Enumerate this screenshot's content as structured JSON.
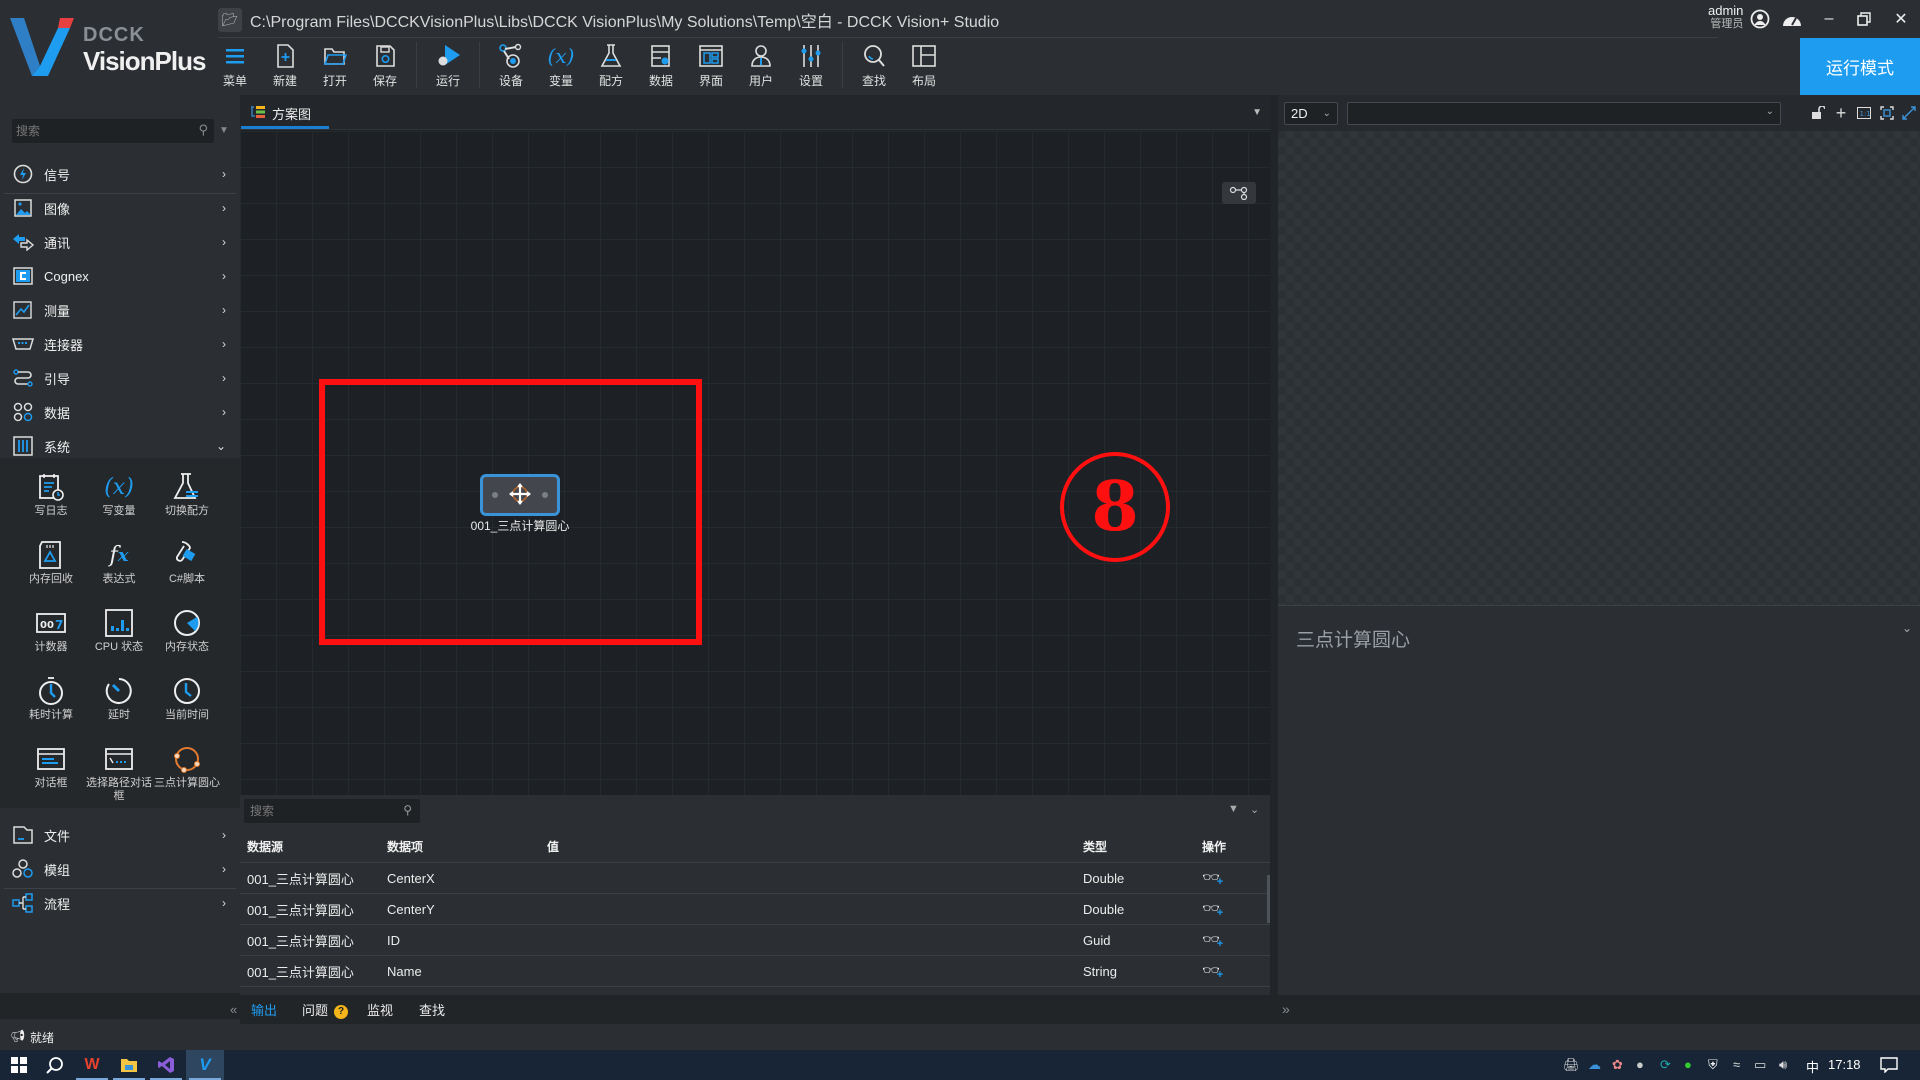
{
  "app": {
    "brand_top": "DCCK",
    "brand_bottom": "VisionPlus",
    "window_title": "C:\\Program Files\\DCCKVisionPlus\\Libs\\DCCK VisionPlus\\My Solutions\\Temp\\空白 - DCCK Vision+ Studio",
    "user_name": "admin",
    "user_role": "管理员",
    "run_mode_label": "运行模式",
    "accent_color": "#1e9cf0"
  },
  "toolbar": {
    "items": [
      {
        "label": "菜单",
        "icon": "menu-icon"
      },
      {
        "label": "新建",
        "icon": "new-file-icon"
      },
      {
        "label": "打开",
        "icon": "open-folder-icon"
      },
      {
        "label": "保存",
        "icon": "save-icon"
      },
      {
        "label": "运行",
        "icon": "run-icon"
      },
      {
        "label": "设备",
        "icon": "device-icon"
      },
      {
        "label": "变量",
        "icon": "variable-icon"
      },
      {
        "label": "配方",
        "icon": "recipe-icon"
      },
      {
        "label": "数据",
        "icon": "data-icon"
      },
      {
        "label": "界面",
        "icon": "interface-icon"
      },
      {
        "label": "用户",
        "icon": "user-icon"
      },
      {
        "label": "设置",
        "icon": "settings-icon"
      },
      {
        "label": "查找",
        "icon": "search-icon"
      },
      {
        "label": "布局",
        "icon": "layout-icon"
      }
    ]
  },
  "sidebar": {
    "search_placeholder": "搜索",
    "categories": [
      {
        "label": "信号",
        "icon": "signal-icon"
      },
      {
        "label": "图像",
        "icon": "image-icon"
      },
      {
        "label": "通讯",
        "icon": "communication-icon"
      },
      {
        "label": "Cognex",
        "icon": "cognex-icon"
      },
      {
        "label": "测量",
        "icon": "measure-icon"
      },
      {
        "label": "连接器",
        "icon": "connector-icon"
      },
      {
        "label": "引导",
        "icon": "guide-icon"
      },
      {
        "label": "数据",
        "icon": "data-icon"
      },
      {
        "label": "系统",
        "icon": "system-icon"
      }
    ],
    "system_tools": [
      {
        "label": "写日志",
        "icon": "write-log-icon"
      },
      {
        "label": "写变量",
        "icon": "write-variable-icon"
      },
      {
        "label": "切换配方",
        "icon": "switch-recipe-icon"
      },
      {
        "label": "内存回收",
        "icon": "memory-recycle-icon"
      },
      {
        "label": "表达式",
        "icon": "expression-icon"
      },
      {
        "label": "C#脚本",
        "icon": "csharp-script-icon"
      },
      {
        "label": "计数器",
        "icon": "counter-icon"
      },
      {
        "label": "CPU 状态",
        "icon": "cpu-status-icon"
      },
      {
        "label": "内存状态",
        "icon": "memory-status-icon"
      },
      {
        "label": "耗时计算",
        "icon": "stopwatch-icon"
      },
      {
        "label": "延时",
        "icon": "delay-icon"
      },
      {
        "label": "当前时间",
        "icon": "clock-icon"
      },
      {
        "label": "对话框",
        "icon": "dialog-icon"
      },
      {
        "label": "选择路径对话框",
        "icon": "path-dialog-icon"
      },
      {
        "label": "三点计算圆心",
        "icon": "three-point-circle-icon"
      }
    ],
    "bottom_categories": [
      {
        "label": "文件",
        "icon": "file-icon"
      },
      {
        "label": "模组",
        "icon": "module-icon"
      },
      {
        "label": "流程",
        "icon": "flow-icon"
      }
    ]
  },
  "editor": {
    "tab_label": "方案图",
    "node_label": "001_三点计算圆心",
    "annotation_number": "8"
  },
  "data_panel": {
    "search_placeholder": "搜索",
    "columns": [
      "数据源",
      "数据项",
      "值",
      "类型",
      "操作"
    ],
    "rows": [
      {
        "source": "001_三点计算圆心",
        "item": "CenterX",
        "value": "",
        "type": "Double"
      },
      {
        "source": "001_三点计算圆心",
        "item": "CenterY",
        "value": "",
        "type": "Double"
      },
      {
        "source": "001_三点计算圆心",
        "item": "ID",
        "value": "",
        "type": "Guid"
      },
      {
        "source": "001_三点计算圆心",
        "item": "Name",
        "value": "",
        "type": "String"
      }
    ]
  },
  "bottom_tabs": {
    "tabs": [
      "输出",
      "问题",
      "监视",
      "查找"
    ],
    "active": "输出",
    "problem_badge": "?"
  },
  "right_panel": {
    "view_mode": "2D",
    "image_source": "",
    "properties_title": "三点计算圆心"
  },
  "status": {
    "text": "就绪"
  },
  "taskbar": {
    "ime": "中",
    "time": "17:18"
  }
}
